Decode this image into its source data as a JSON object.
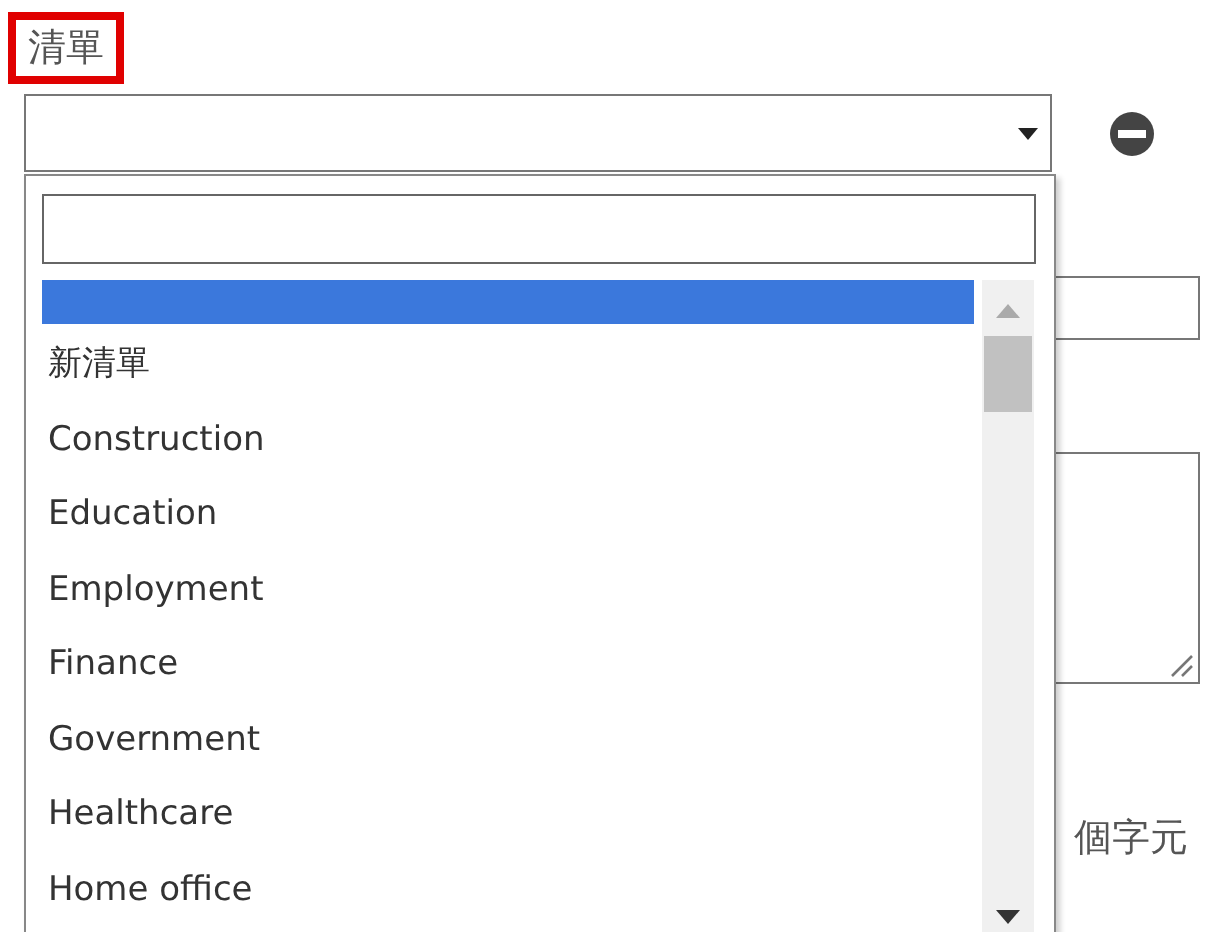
{
  "list_field": {
    "label": "清單",
    "label_highlighted": true
  },
  "dropdown": {
    "options": [
      {
        "selected": true
      },
      {
        "label": "新清單",
        "selected": false
      },
      {
        "label": "Construction",
        "selected": false
      },
      {
        "label": "Education",
        "selected": false
      },
      {
        "label": "Employment",
        "selected": false
      },
      {
        "label": "Finance",
        "selected": false
      },
      {
        "label": "Government",
        "selected": false
      },
      {
        "label": "Healthcare",
        "selected": false
      },
      {
        "label": "Home office",
        "selected": false
      }
    ]
  },
  "counter_text": "個字元"
}
